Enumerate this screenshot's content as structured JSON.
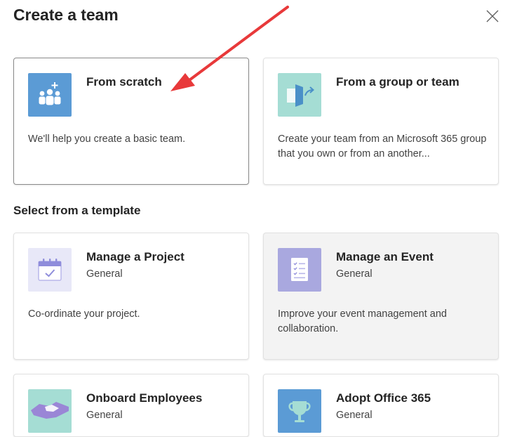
{
  "dialog": {
    "title": "Create a team",
    "close_icon": "close-icon"
  },
  "create_options": [
    {
      "title": "From scratch",
      "description": "We'll help you create a basic team.",
      "icon": "people-add-icon",
      "icon_bg": "#5b9bd5"
    },
    {
      "title": "From a group or team",
      "description": "Create your team from an Microsoft 365 group that you own or from an another...",
      "icon": "group-import-icon",
      "icon_bg": "#a5ddd4"
    }
  ],
  "template_section": {
    "title": "Select from a template"
  },
  "templates": [
    {
      "title": "Manage a Project",
      "category": "General",
      "description": "Co-ordinate your project.",
      "icon": "calendar-check-icon",
      "icon_bg": "#e8e8f8"
    },
    {
      "title": "Manage an Event",
      "category": "General",
      "description": "Improve your event management and collaboration.",
      "icon": "checklist-icon",
      "icon_bg": "#a9a8df"
    },
    {
      "title": "Onboard Employees",
      "category": "General",
      "icon": "handshake-icon",
      "icon_bg": "#a5ddd4"
    },
    {
      "title": "Adopt Office 365",
      "category": "General",
      "icon": "trophy-icon",
      "icon_bg": "#5b9bd5"
    }
  ],
  "colors": {
    "annotation_arrow": "#e8393a",
    "selected_border": "#8a8a8a",
    "card_border": "#e1e1e1",
    "hover_bg": "#f3f3f3"
  }
}
